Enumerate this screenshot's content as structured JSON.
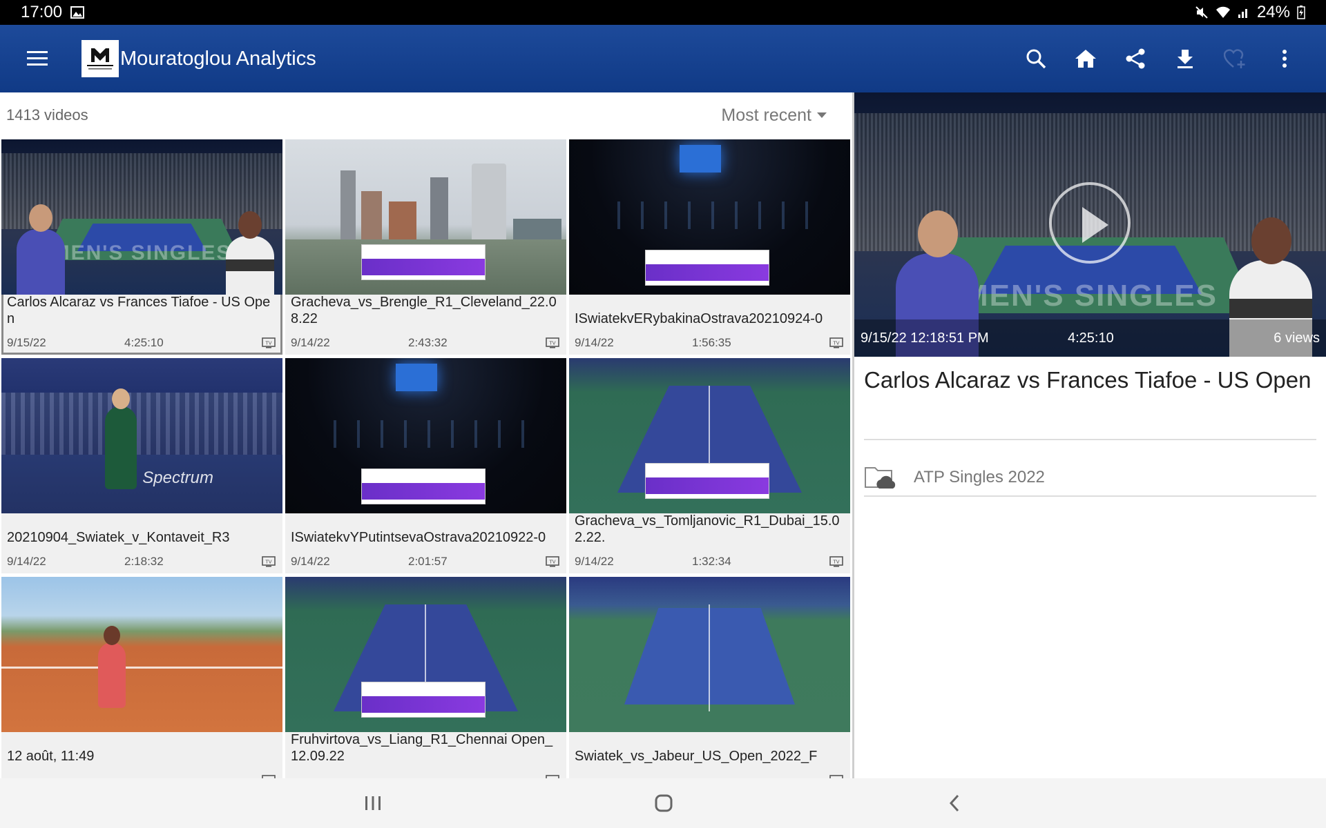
{
  "status_bar": {
    "time": "17:00",
    "battery": "24%"
  },
  "app_bar": {
    "title": "Mouratoglou Analytics",
    "logo_text": "MOURATOGLOU",
    "actions": [
      "search-icon",
      "home-icon",
      "share-icon",
      "download-icon",
      "heart-add-icon",
      "more-vert-icon"
    ]
  },
  "list": {
    "count_label": "1413 videos",
    "sort_label": "Most recent"
  },
  "videos": [
    {
      "title": "Carlos Alcaraz vs Frances Tiafoe - US Open",
      "date": "9/15/22",
      "duration": "4:25:10"
    },
    {
      "title": "Gracheva_vs_Brengle_R1_Cleveland_22.08.22",
      "date": "9/14/22",
      "duration": "2:43:32"
    },
    {
      "title": "ISwiatekvERybakinaOstrava20210924-0",
      "date": "9/14/22",
      "duration": "1:56:35"
    },
    {
      "title": "20210904_Swiatek_v_Kontaveit_R3",
      "date": "9/14/22",
      "duration": "2:18:32"
    },
    {
      "title": "ISwiatekvYPutintsevaOstrava20210922-0",
      "date": "9/14/22",
      "duration": "2:01:57"
    },
    {
      "title": "Gracheva_vs_Tomljanovic_R1_Dubai_15.02.22.",
      "date": "9/14/22",
      "duration": "1:32:34"
    },
    {
      "title": "12 août, 11:49",
      "date": "",
      "duration": ""
    },
    {
      "title": "Fruhvirtova_vs_Liang_R1_Chennai Open_12.09.22",
      "date": "",
      "duration": ""
    },
    {
      "title": "Swiatek_vs_Jabeur_US_Open_2022_F",
      "date": "",
      "duration": ""
    }
  ],
  "thumb_text": {
    "spectrum": "Spectrum",
    "mens_singles": "MEN'S SINGLES"
  },
  "detail": {
    "date": "9/15/22 12:18:51 PM",
    "duration": "4:25:10",
    "views": "6 views",
    "title": "Carlos Alcaraz vs Frances Tiafoe - US Open",
    "category": "ATP Singles 2022"
  },
  "colors": {
    "app_bar": "#1d4a9a",
    "status_bar": "#000000",
    "accent_purple": "#6a2fc8"
  }
}
